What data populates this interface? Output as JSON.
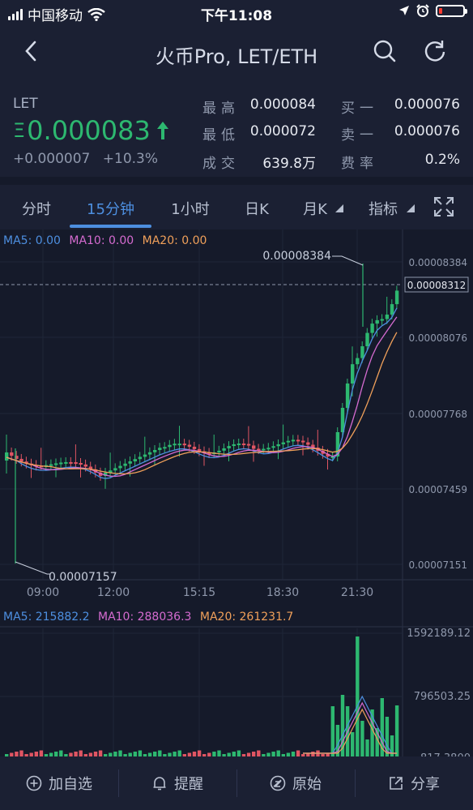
{
  "status_bar": {
    "carrier": "中国移动",
    "time": "下午11:08",
    "battery_level": 0.15,
    "icons": [
      "signal-icon",
      "wifi-icon",
      "location-icon",
      "alarm-icon",
      "battery-icon"
    ]
  },
  "nav": {
    "title": "火币Pro, LET/ETH",
    "icons": [
      "back-icon",
      "search-icon",
      "refresh-icon"
    ]
  },
  "ticker": {
    "symbol": "LET",
    "price_prefix": "Ξ",
    "price": "0.000083",
    "change_abs": "+0.000007",
    "change_pct": "+10.3%",
    "high_label": "最高",
    "high": "0.000084",
    "low_label": "最低",
    "low": "0.000072",
    "volume_label": "成交",
    "volume": "639.8万",
    "bid_label": "买一",
    "bid": "0.000076",
    "ask_label": "卖一",
    "ask": "0.000076",
    "fee_label": "费率",
    "fee": "0.2%",
    "up_color": "#2db870",
    "down_color": "#e05563"
  },
  "tabs": [
    {
      "label": "分时"
    },
    {
      "label": "15分钟",
      "active": true
    },
    {
      "label": "1小时"
    },
    {
      "label": "日K"
    },
    {
      "label": "月K"
    },
    {
      "label": "指标"
    }
  ],
  "kline": {
    "ma_legend": [
      {
        "label": "MA5: 0.00",
        "color": "#4d8fe0"
      },
      {
        "label": "MA10: 0.00",
        "color": "#d56bd0"
      },
      {
        "label": "MA20: 0.00",
        "color": "#f0a05a"
      }
    ],
    "y_ticks": [
      "0.00008384",
      "0.00008076",
      "0.00007768",
      "0.00007459",
      "0.00007151"
    ],
    "current_price_label": "0.00008312",
    "high_marker": "0.00008384",
    "low_marker": "0.00007157",
    "x_ticks": [
      "09:00",
      "12:00",
      "15:15",
      "18:30",
      "21:30"
    ]
  },
  "volume": {
    "ma_legend": [
      {
        "label": "MA5: 215882.2",
        "color": "#4d8fe0"
      },
      {
        "label": "MA10: 288036.3",
        "color": "#d56bd0"
      },
      {
        "label": "MA20: 261231.7",
        "color": "#f0a05a"
      }
    ],
    "y_ticks": [
      "1592189.12",
      "796503.25",
      "817.3800"
    ]
  },
  "bottom_bar": [
    {
      "label": "加自选",
      "icon": "plus-circle-icon"
    },
    {
      "label": "提醒",
      "icon": "bell-icon"
    },
    {
      "label": "原始",
      "icon": "no-filter-icon"
    },
    {
      "label": "分享",
      "icon": "share-icon"
    }
  ]
}
